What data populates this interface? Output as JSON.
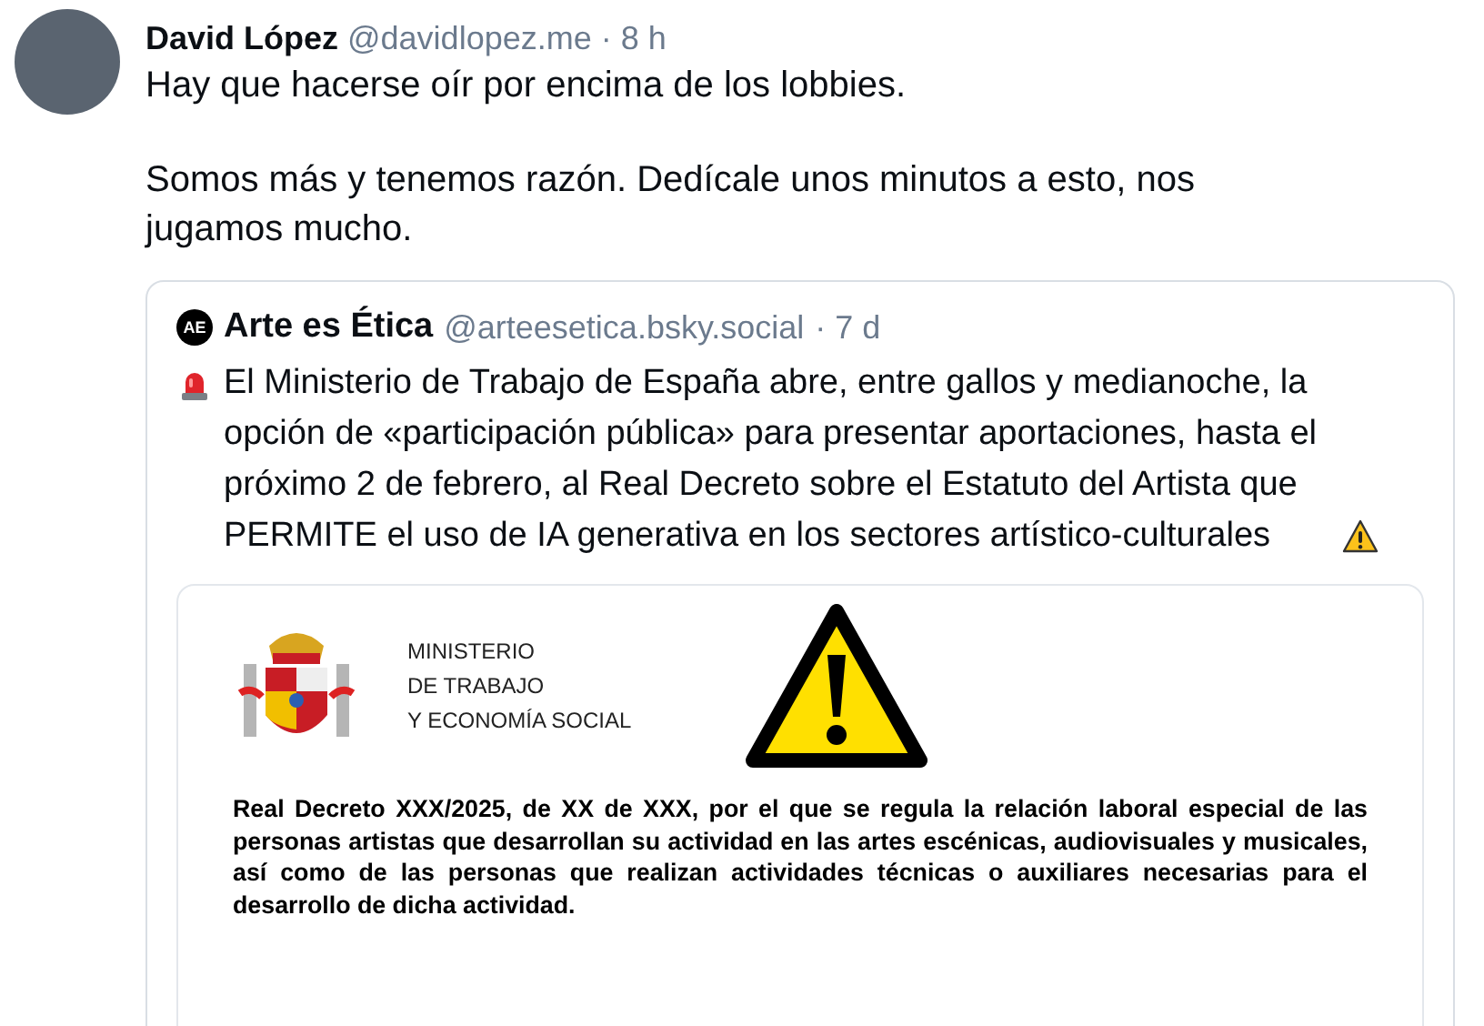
{
  "post": {
    "author": "David López",
    "handle": "@davidlopez.me",
    "time": "· 8 h",
    "paragraphs": [
      "Hay que hacerse oír por encima de los lobbies.",
      "Somos más y tenemos razón. Dedícale unos minutos a esto, nos jugamos mucho."
    ]
  },
  "quote": {
    "logo_text": "AE",
    "author": "Arte es Ética",
    "handle": "@arteesetica.bsky.social",
    "time": "· 7 d",
    "text": "El Ministerio de Trabajo de España abre, entre gallos y medianoche, la opción de «participación pública» para presentar aportaciones, hasta el próximo 2 de febrero, al Real Decreto sobre el Estatuto del Artista que PERMITE el uso de IA generativa en los sectores artístico-culturales",
    "document": {
      "ministry_lines": [
        "MINISTERIO",
        "DE TRABAJO",
        "Y ECONOMÍA SOCIAL"
      ],
      "heading": "Real Decreto XXX/2025, de XX de XXX, por el que se regula la relación laboral especial de las personas artistas que desarrollan su actividad en las artes escénicas, audiovisuales y musicales, así como de las personas que realizan actividades técnicas o auxiliares necesarias para el desarrollo de dicha actividad."
    }
  }
}
